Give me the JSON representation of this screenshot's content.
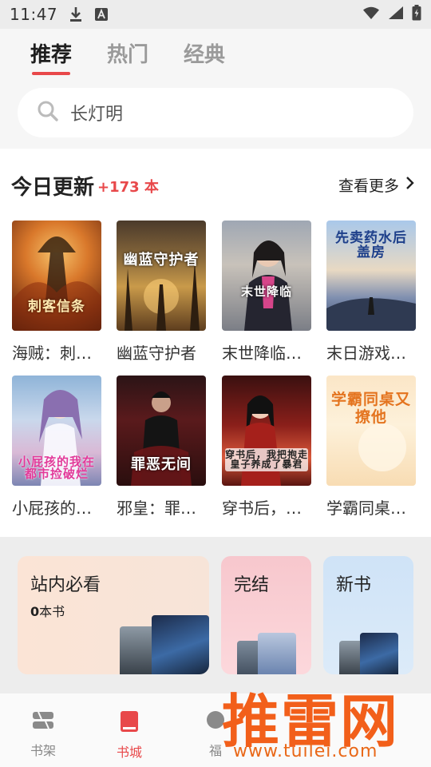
{
  "status_bar": {
    "time": "11:47"
  },
  "tabs": [
    {
      "label": "推荐",
      "active": true
    },
    {
      "label": "热门",
      "active": false
    },
    {
      "label": "经典",
      "active": false
    }
  ],
  "search": {
    "text": "长灯明"
  },
  "today_update": {
    "title": "今日更新",
    "count": "+173 本",
    "more_label": "查看更多"
  },
  "books": [
    {
      "title": "海贼：刺…",
      "cover_text": "刺客信条"
    },
    {
      "title": "幽蓝守护者",
      "cover_text": "幽蓝守护者"
    },
    {
      "title": "末世降临…",
      "cover_text": "末世降临"
    },
    {
      "title": "末日游戏…",
      "cover_text": "先卖药水后盖房"
    },
    {
      "title": "小屁孩的…",
      "cover_text": "小屁孩的我在都市捡破烂"
    },
    {
      "title": "邪皇：罪…",
      "cover_text": "罪恶无间"
    },
    {
      "title": "穿书后，…",
      "cover_text": "穿书后，我把抱走皇子养成了暴君"
    },
    {
      "title": "学霸同桌…",
      "cover_text": "学霸同桌又撩他"
    }
  ],
  "categories": [
    {
      "title": "站内必看",
      "count": "0",
      "unit": "本书"
    },
    {
      "title": "完结"
    },
    {
      "title": "新书"
    }
  ],
  "bottom_nav": [
    {
      "label": "书架",
      "active": false
    },
    {
      "label": "书城",
      "active": true
    },
    {
      "label": "福",
      "active": false
    }
  ],
  "watermark": {
    "name": "推雷网",
    "url": "www.tuilei.com"
  },
  "colors": {
    "accent": "#e8484a",
    "watermark": "#f25f1a"
  }
}
